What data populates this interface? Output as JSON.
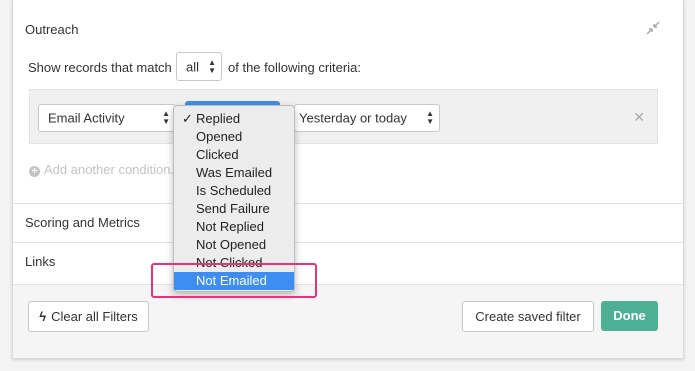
{
  "sections": {
    "outreach_title": "Outreach",
    "scoring_title": "Scoring and Metrics",
    "links_title": "Links"
  },
  "criteria": {
    "prefix": "Show records that match",
    "match_value": "all",
    "suffix": "of the following criteria:"
  },
  "condition": {
    "field": "Email Activity",
    "value": "Yesterday or today",
    "add_label": "Add another condition..."
  },
  "dropdown": {
    "options": [
      "Replied",
      "Opened",
      "Clicked",
      "Was Emailed",
      "Is Scheduled",
      "Send Failure",
      "Not Replied",
      "Not Opened",
      "Not Clicked",
      "Not Emailed"
    ],
    "checked": "Replied",
    "highlighted": "Not Emailed"
  },
  "footer": {
    "clear_label": "Clear all Filters",
    "save_label": "Create saved filter",
    "done_label": "Done"
  },
  "colors": {
    "done_button": "#4daf94",
    "highlight_border": "#e8327a",
    "selection": "#3d8ef0"
  }
}
